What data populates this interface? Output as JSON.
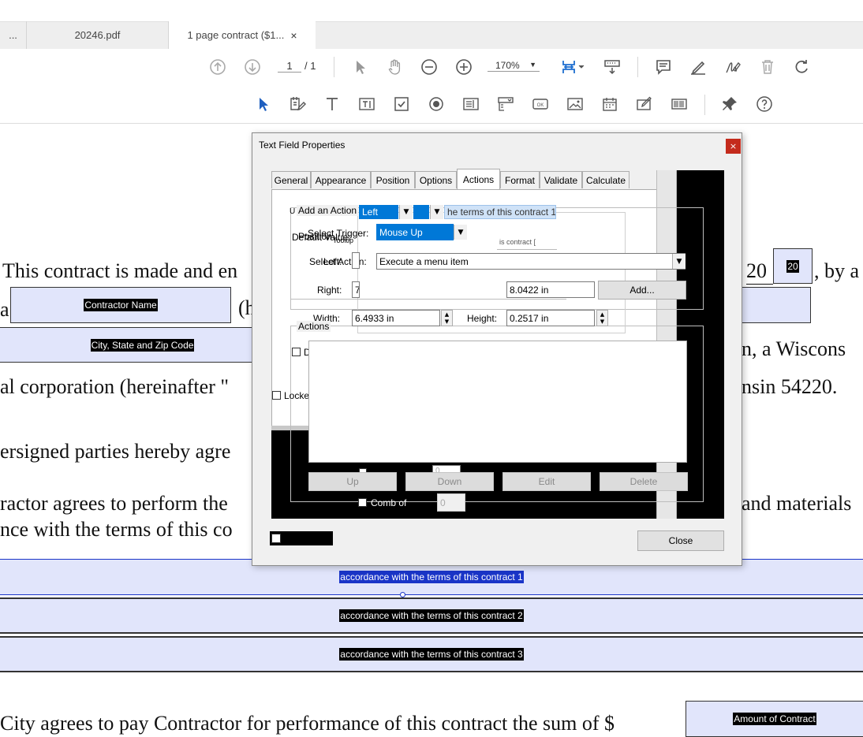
{
  "tabs": [
    {
      "label": "..."
    },
    {
      "label": "20246.pdf"
    },
    {
      "label": "1 page contract ($1...",
      "close": "×"
    }
  ],
  "toolbar": {
    "page_current": "1",
    "page_total": "/ 1",
    "zoom": "170%",
    "icons": [
      "prev-page-icon",
      "next-page-icon",
      "select-icon",
      "hand-icon",
      "zoom-out-icon",
      "zoom-in-icon",
      "fit-page-icon",
      "scroll-mode-icon",
      "comment-icon",
      "highlight-icon",
      "sign-icon",
      "delete-icon",
      "rotate-icon"
    ]
  },
  "form_toolbar": {
    "icons": [
      "select-object-icon",
      "edit-fields-icon",
      "text-icon",
      "text-field-icon",
      "checkbox-icon",
      "radio-icon",
      "list-box-icon",
      "dropdown-icon",
      "button-icon",
      "image-field-icon",
      "date-field-icon",
      "signature-field-icon",
      "barcode-icon",
      "pin-icon",
      "help-icon"
    ]
  },
  "document": {
    "line1_left": "This contract is made and en",
    "line1_year": "20",
    "line1_right": ", by a",
    "year_field": "20",
    "contractor_field": "Contractor Name",
    "paren_h": "(h",
    "city_field": "City, State and Zip Code",
    "line_wisconsin": "n,  a  Wiscons",
    "line2_left": "al corporation (hereinafter \"",
    "line2_right": "nsin 54220.",
    "line3": "ersigned parties hereby agre",
    "line4_left": "ractor agrees to perform the",
    "line4_right": "and materials",
    "line5": "nce with the terms of this co",
    "contract_fields": [
      "accordance with the terms of this contract 1",
      "accordance with the terms of this contract 2",
      "accordance with the terms of this contract 3"
    ],
    "line6": "City agrees to pay Contractor for performance of this contract the sum of  $",
    "amount_field": "Amount of Contract"
  },
  "dialog": {
    "title": "Text Field Properties",
    "close_x": "×",
    "tabs": [
      "General",
      "Appearance",
      "Position",
      "Options",
      "Actions",
      "Format",
      "Validate",
      "Calculate"
    ],
    "active_tab": "Actions",
    "add_action_label": "Add an Action",
    "overlap_left_value": "Left",
    "overlap_name_value": "he terms of this contract 1",
    "default_value_label": "Default Value:",
    "position_label": "Position",
    "tooltip_label": "Tooltip",
    "select_trigger_label": "Select Trigger:",
    "trigger_value": "Mouse Up",
    "overlap_tooltip_text": "is contract [",
    "select_action_label": "Select Action:",
    "left_label": "Left:",
    "action_value": "Execute a menu item",
    "right_label": "Right:",
    "right_value": "7",
    "top_value": "8.0422 in",
    "add_button": "Add...",
    "width_label": "Width:",
    "width_value": "6.4933 in",
    "height_label": "Height:",
    "height_value": "0.2517 in",
    "actions_label": "Actions",
    "d_label": "D",
    "locked_label": "Locke",
    "comb_label": "Comb of",
    "comb_value": "0",
    "small_value": "0",
    "up_button": "Up",
    "down_button": "Down",
    "edit_button": "Edit",
    "delete_button": "Delete",
    "close_button": "Close"
  },
  "colors": {
    "field_fill": "#e1e5fb",
    "selection_blue": "#0078d7",
    "dialog_bg": "#f0f0f0",
    "close_red": "#c42b1c"
  }
}
